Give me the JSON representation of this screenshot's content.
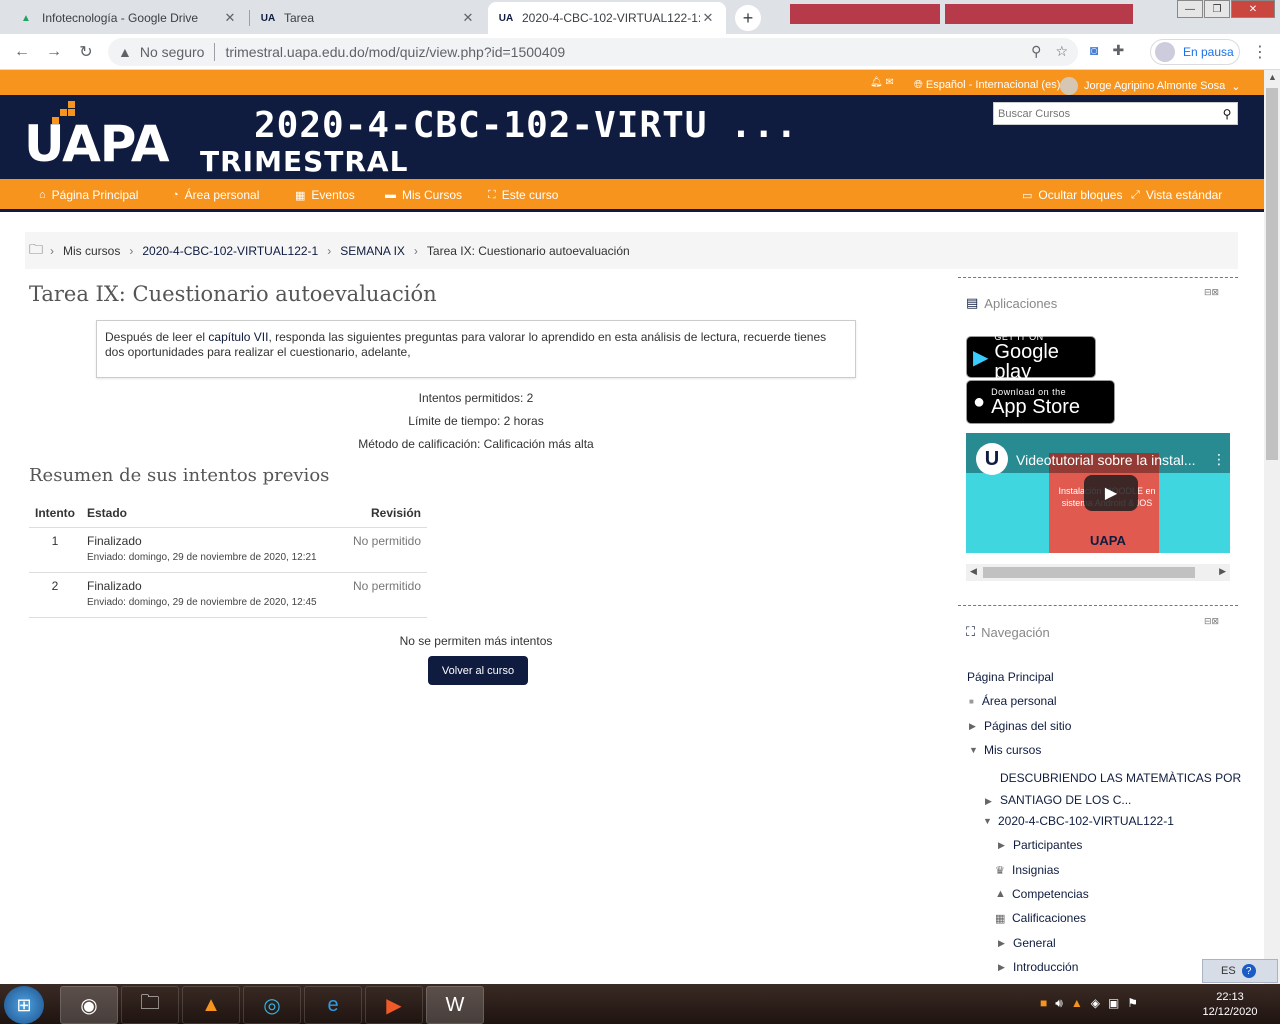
{
  "browser": {
    "tabs": [
      {
        "title": "Infotecnología - Google Drive",
        "icon": "google-drive-icon"
      },
      {
        "title": "Tarea",
        "icon": "uapa-favicon-icon"
      },
      {
        "title": "2020-4-CBC-102-VIRTUAL122-1:",
        "icon": "uapa-favicon-icon"
      }
    ],
    "insecure_label": "No seguro",
    "url": "trimestral.uapa.edu.do/mod/quiz/view.php?id=1500409",
    "profile_status": "En pausa"
  },
  "topstrip": {
    "language": "Español - Internacional (es)",
    "user_name": "Jorge Agripino Almonte Sosa"
  },
  "header": {
    "logo": "UAPA",
    "logo_sub": "TRIMESTRAL",
    "course_title": "2020-4-CBC-102-VIRTU ...",
    "search_placeholder": "Buscar Cursos"
  },
  "navbar": {
    "items": [
      "Página Principal",
      "Área personal",
      "Eventos",
      "Mis Cursos",
      "Este curso"
    ],
    "hide_blocks": "Ocultar bloques",
    "standard_view": "Vista estándar"
  },
  "breadcrumb": [
    "Mis cursos",
    "2020-4-CBC-102-VIRTUAL122-1",
    "SEMANA IX",
    "Tarea IX: Cuestionario autoevaluación"
  ],
  "quiz": {
    "title": "Tarea IX: Cuestionario autoevaluación",
    "intro_before": "Después de leer el ",
    "intro_link": "capítulo VII",
    "intro_after": ", responda las siguientes preguntas para valorar lo aprendido en esta análisis de lectura, recuerde tienes dos oportunidades para realizar el cuestionario, adelante,",
    "attempts_allowed": "Intentos permitidos: 2",
    "time_limit": "Límite de tiempo: 2 horas",
    "grading_method": "Método de calificación: Calificación más alta",
    "summary_title": "Resumen de sus intentos previos",
    "table_headers": [
      "Intento",
      "Estado",
      "Revisión"
    ],
    "attempts": [
      {
        "num": "1",
        "state": "Finalizado",
        "sent": "Enviado: domingo, 29 de noviembre de 2020, 12:21",
        "review": "No permitido"
      },
      {
        "num": "2",
        "state": "Finalizado",
        "sent": "Enviado: domingo, 29 de noviembre de 2020, 12:45",
        "review": "No permitido"
      }
    ],
    "no_more": "No se permiten más intentos",
    "back_button": "Volver al curso"
  },
  "sidebar": {
    "apps_title": "Aplicaciones",
    "google_play_small": "GET IT ON",
    "google_play_big": "Google play",
    "app_store_small": "Download on the",
    "app_store_big": "App Store",
    "video_title": "Videotutorial sobre la instal...",
    "video_sub": "Instalación MOODLE en sistema Android & IOS",
    "video_brand": "UAPA",
    "nav_title": "Navegación",
    "nav_items": [
      "Página Principal",
      "Área personal",
      "Páginas del sitio",
      "Mis cursos",
      "DESCUBRIENDO LAS MATEMÀTICAS POR",
      "SANTIAGO DE LOS C...",
      "2020-4-CBC-102-VIRTUAL122-1",
      "Participantes",
      "Insignias",
      "Competencias",
      "Calificaciones",
      "General",
      "Introducción"
    ]
  },
  "taskbar": {
    "lang": "ES",
    "time": "22:13",
    "date": "12/12/2020"
  }
}
